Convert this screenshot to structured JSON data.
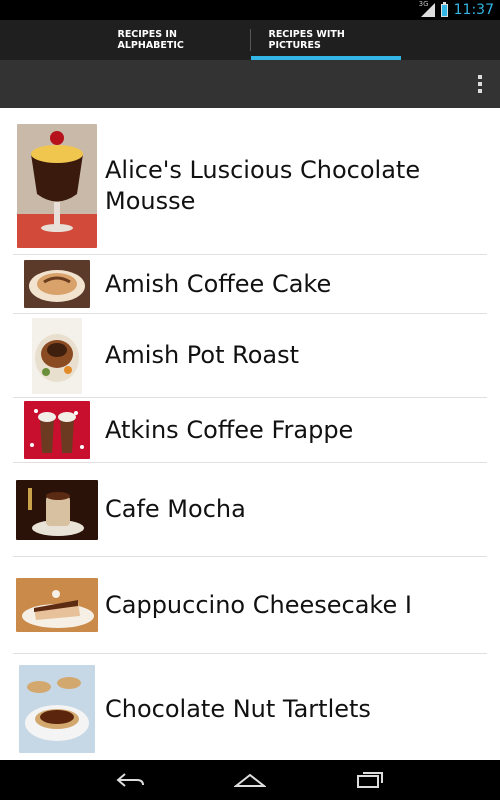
{
  "status_bar": {
    "network": "3G",
    "time": "11:37"
  },
  "tabs": [
    {
      "label": "RECIPES IN ALPHABETIC",
      "selected": false
    },
    {
      "label": "RECIPES WITH PICTURES",
      "selected": true
    }
  ],
  "recipes": [
    {
      "title": "Alice's Luscious Chocolate Mousse",
      "thumb_colors": [
        "#f1c64f",
        "#4a1d0e",
        "#c14a2a"
      ]
    },
    {
      "title": "Amish Coffee Cake",
      "thumb_colors": [
        "#d8a26a",
        "#6b3b1e",
        "#f2e3cf"
      ]
    },
    {
      "title": "Amish Pot Roast",
      "thumb_colors": [
        "#8a4a22",
        "#3f1f0e",
        "#6a8f3a"
      ]
    },
    {
      "title": "Atkins Coffee Frappe",
      "thumb_colors": [
        "#c8102e",
        "#6b3a21",
        "#f2efe9"
      ]
    },
    {
      "title": "Cafe Mocha",
      "thumb_colors": [
        "#5a2a12",
        "#d8c1a0",
        "#2a1208"
      ]
    },
    {
      "title": "Cappuccino Cheesecake I",
      "thumb_colors": [
        "#a15a2a",
        "#e6c19a",
        "#5d2a12"
      ]
    },
    {
      "title": "Chocolate Nut Tartlets",
      "thumb_colors": [
        "#5a250c",
        "#d2a86f",
        "#c6d8e6"
      ]
    }
  ],
  "colors": {
    "accent": "#33b5e5"
  }
}
